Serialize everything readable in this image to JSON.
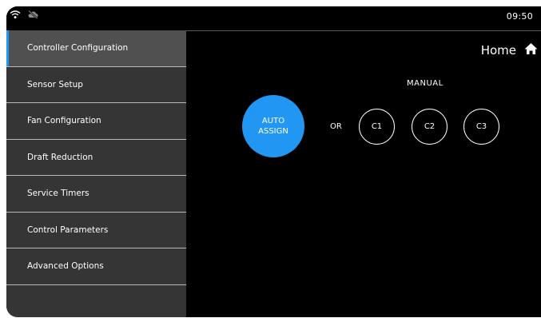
{
  "status_bar": {
    "time": "09:50",
    "icons": [
      "wifi-icon",
      "cloud-offline-icon"
    ]
  },
  "sidebar": {
    "items": [
      {
        "label": "Controller Configuration",
        "active": true
      },
      {
        "label": "Sensor Setup",
        "active": false
      },
      {
        "label": "Fan Configuration",
        "active": false
      },
      {
        "label": "Draft Reduction",
        "active": false
      },
      {
        "label": "Service Timers",
        "active": false
      },
      {
        "label": "Control Parameters",
        "active": false
      },
      {
        "label": "Advanced Options",
        "active": false
      }
    ]
  },
  "header": {
    "home_label": "Home",
    "home_icon": "home-icon"
  },
  "main": {
    "auto_assign_line1": "AUTO",
    "auto_assign_line2": "ASSIGN",
    "or_label": "OR",
    "manual_label": "MANUAL",
    "manual_buttons": [
      "C1",
      "C2",
      "C3"
    ]
  },
  "colors": {
    "accent": "#2196f3",
    "background": "#000000",
    "sidebar": "#353535",
    "sidebar_active": "#505050"
  }
}
